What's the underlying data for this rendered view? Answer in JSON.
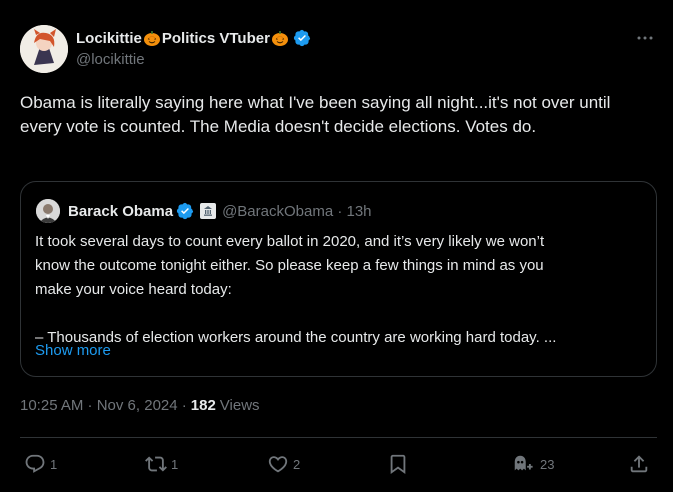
{
  "tweet": {
    "author": {
      "display_name": "Locikittie",
      "name_suffix": "Politics VTuber",
      "handle": "@locikittie",
      "verified": true
    },
    "text": "Obama is literally saying here what I've been saying all night...it's not over until every vote is counted. The Media doesn't decide elections. Votes do.",
    "quote": {
      "author_name": "Barack Obama",
      "handle_time": "@BarackObama · 13h",
      "lines": [
        "It took several days to count every ballot in 2020, and it’s very likely we won’t",
        "know the outcome tonight either. So please keep a few things in mind as you",
        "make your voice heard today:",
        "",
        "– Thousands of election workers around the country are working hard today. ..."
      ],
      "show_more": "Show more"
    },
    "meta": {
      "timestamp": "10:25 AM · Nov 6, 2024 ·",
      "views_count": "182",
      "views_label": "Views"
    },
    "actions": {
      "replies": "1",
      "reposts": "1",
      "likes": "2",
      "grok_count": "23"
    },
    "colors": {
      "accent": "#1d9bf0",
      "text": "#e7e9ea",
      "muted": "#71767b",
      "border": "#2f3336",
      "background": "#000000"
    },
    "icons": [
      "more-icon",
      "verified-badge-icon",
      "pumpkin-icon",
      "reply-icon",
      "repost-icon",
      "like-icon",
      "bookmark-icon",
      "grok-icon",
      "share-icon"
    ]
  }
}
